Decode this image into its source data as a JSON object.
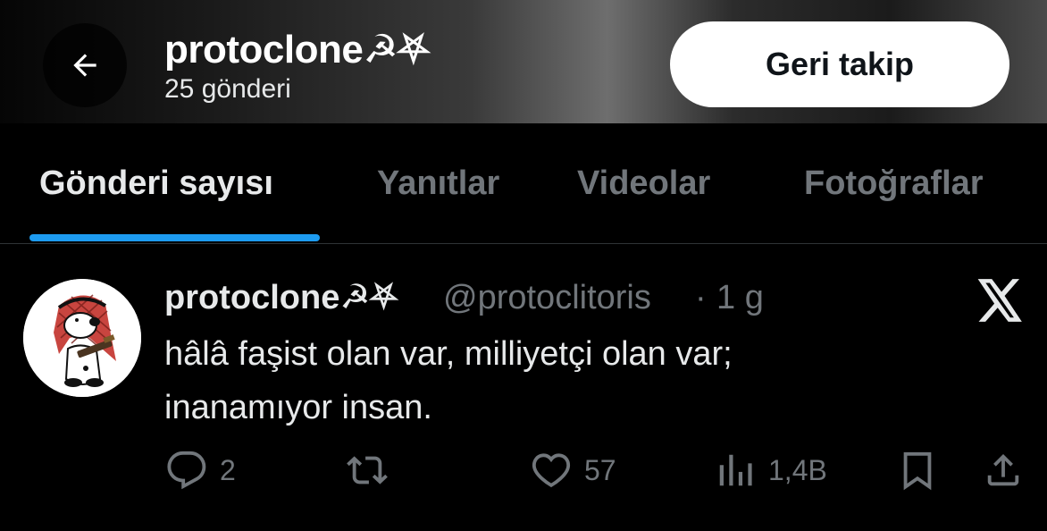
{
  "header": {
    "back_icon": "arrow-left-icon",
    "profile_name": "protoclone☭⛧",
    "post_count": "25 gönderi",
    "follow_button": "Geri takip"
  },
  "tabs": [
    {
      "label": "Gönderi sayısı",
      "active": true
    },
    {
      "label": "Yanıtlar",
      "active": false
    },
    {
      "label": "Videolar",
      "active": false
    },
    {
      "label": "Fotoğraflar",
      "active": false
    }
  ],
  "post": {
    "author_name": "protoclone☭⛧",
    "handle": "@protoclitoris",
    "separator": "·",
    "time": "1 g",
    "text_lines": [
      "hâlâ faşist olan var, milliyetçi olan var;",
      "inanamıyor insan."
    ],
    "actions": {
      "reply_count": "2",
      "retweet_count": "",
      "like_count": "57",
      "views_count": "1,4B"
    }
  },
  "colors": {
    "accent": "#1d9bf0",
    "muted": "#71767b",
    "text": "#e7e9ea",
    "background": "#000000"
  }
}
